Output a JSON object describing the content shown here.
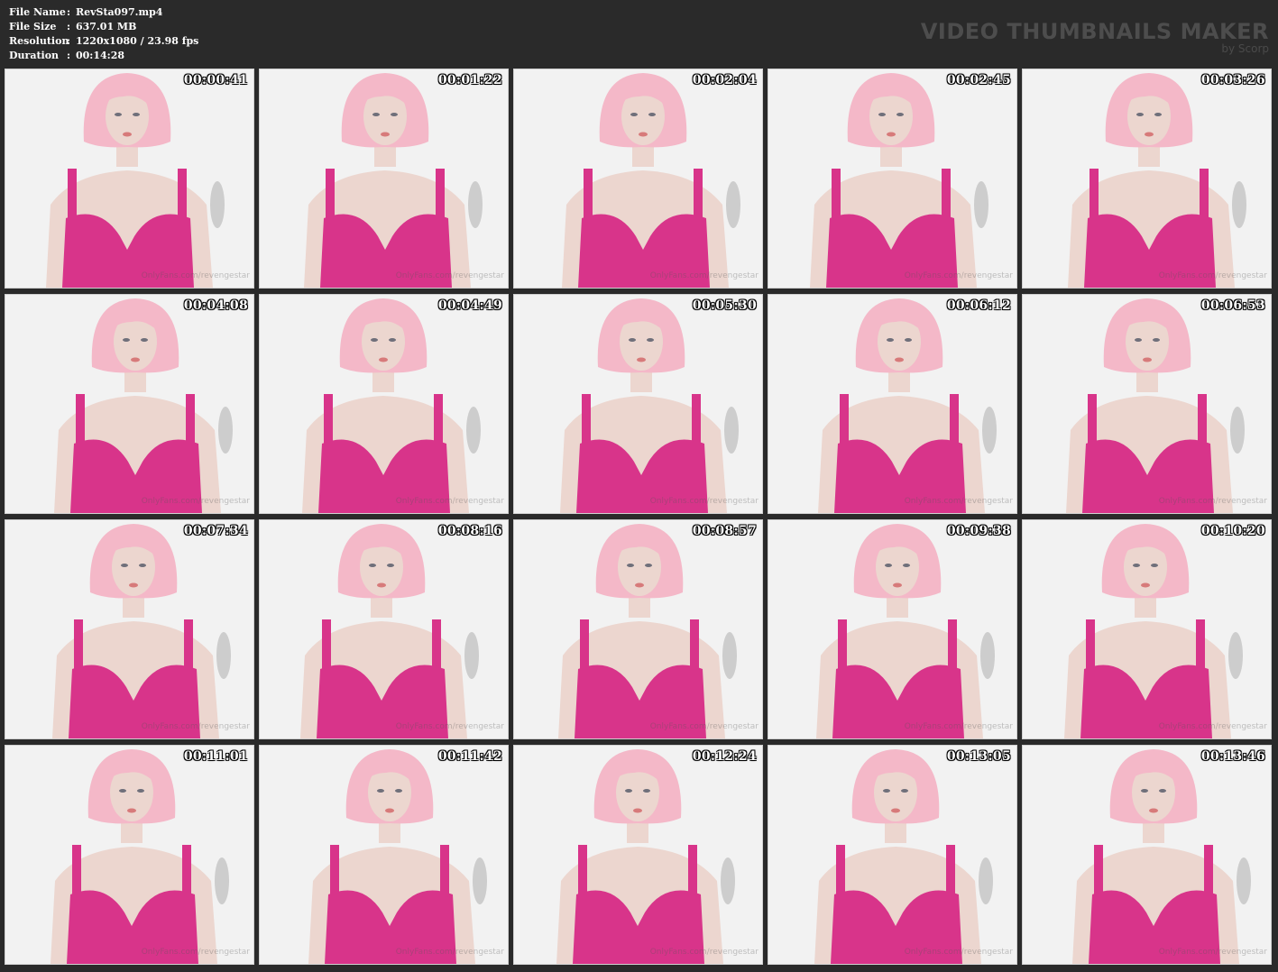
{
  "header": {
    "file_name_label": "File Name",
    "file_name_value": "RevSta097.mp4",
    "file_size_label": "File Size",
    "file_size_value": "637.01 MB",
    "resolution_label": "Resolution",
    "resolution_value": "1220x1080 / 23.98 fps",
    "duration_label": "Duration",
    "duration_value": "00:14:28",
    "separator": ":",
    "brand_title": "VIDEO THUMBNAILS MAKER",
    "brand_sub": "by Scorp"
  },
  "thumbnail_watermark": "OnlyFans.com/revengestar",
  "colors": {
    "background": "#2a2a2a",
    "frame_bg": "#f2f2f2",
    "wig": "#f4b8c8",
    "dress": "#d8348a",
    "skin": "#ecd6cf"
  },
  "thumbnails": [
    {
      "time": "00:00:41"
    },
    {
      "time": "00:01:22"
    },
    {
      "time": "00:02:04"
    },
    {
      "time": "00:02:45"
    },
    {
      "time": "00:03:26"
    },
    {
      "time": "00:04:08"
    },
    {
      "time": "00:04:49"
    },
    {
      "time": "00:05:30"
    },
    {
      "time": "00:06:12"
    },
    {
      "time": "00:06:53"
    },
    {
      "time": "00:07:34"
    },
    {
      "time": "00:08:16"
    },
    {
      "time": "00:08:57"
    },
    {
      "time": "00:09:38"
    },
    {
      "time": "00:10:20"
    },
    {
      "time": "00:11:01"
    },
    {
      "time": "00:11:42"
    },
    {
      "time": "00:12:24"
    },
    {
      "time": "00:13:05"
    },
    {
      "time": "00:13:46"
    }
  ]
}
